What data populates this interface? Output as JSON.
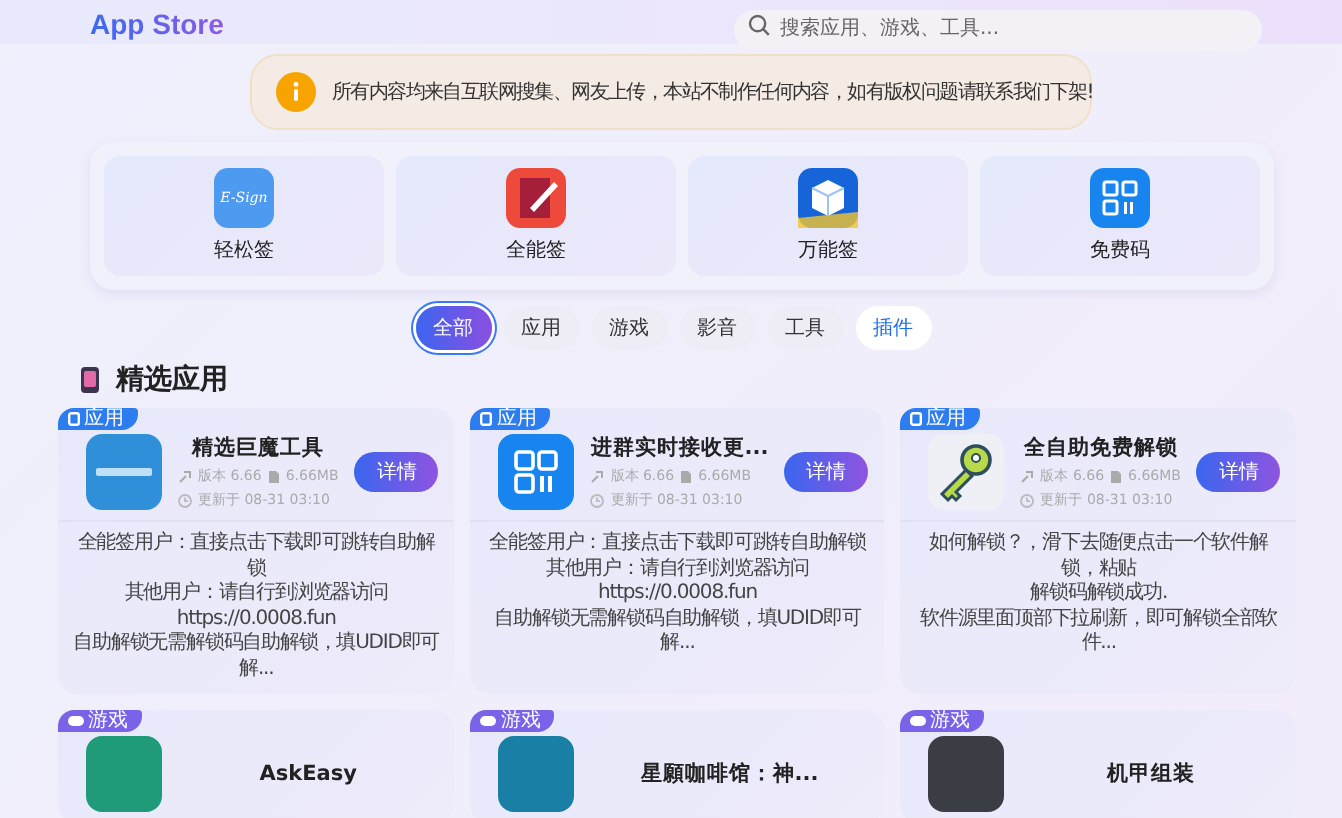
{
  "header": {
    "logo": "App Store",
    "search": {
      "placeholder": "搜索应用、游戏、工具..."
    }
  },
  "notice": {
    "text": "所有内容均来自互联网搜集、网友上传，本站不制作任何内容，如有版权问题请联系我们下架!"
  },
  "shortcuts": [
    {
      "label": "轻松签",
      "kind": "esign",
      "icon_text": "E-Sign"
    },
    {
      "label": "全能签",
      "kind": "pen"
    },
    {
      "label": "万能签",
      "kind": "cube"
    },
    {
      "label": "免费码",
      "kind": "qr"
    }
  ],
  "filters": [
    {
      "label": "全部",
      "selected": true,
      "hovered": false
    },
    {
      "label": "应用",
      "selected": false,
      "hovered": false
    },
    {
      "label": "游戏",
      "selected": false,
      "hovered": false
    },
    {
      "label": "影音",
      "selected": false,
      "hovered": false
    },
    {
      "label": "工具",
      "selected": false,
      "hovered": false
    },
    {
      "label": "插件",
      "selected": false,
      "hovered": true
    }
  ],
  "section": {
    "title": "精选应用"
  },
  "apps": [
    {
      "badge": "应用",
      "kind": "app",
      "title": "精选巨魔工具",
      "version": "版本 6.66",
      "size": "6.66MB",
      "updated": "更新于 08-31 03:10",
      "button": "详情",
      "description": [
        "全能签用户：直接点击下载即可跳转自助解锁",
        "其他用户：请自行到浏览器访问https://0.0008.fun",
        "自助解锁无需解锁码自助解锁，填UDID即可解..."
      ]
    },
    {
      "badge": "应用",
      "kind": "app",
      "title": "进群实时接收更...",
      "version": "版本 6.66",
      "size": "6.66MB",
      "updated": "更新于 08-31 03:10",
      "button": "详情",
      "description": [
        "全能签用户：直接点击下载即可跳转自助解锁",
        "其他用户：请自行到浏览器访问https://0.0008.fun",
        "自助解锁无需解锁码自助解锁，填UDID即可解..."
      ]
    },
    {
      "badge": "应用",
      "kind": "app",
      "title": "全自助免费解锁",
      "version": "版本 6.66",
      "size": "6.66MB",
      "updated": "更新于 08-31 03:10",
      "button": "详情",
      "description": [
        "如何解锁？，滑下去随便点击一个软件解锁，粘贴",
        "解锁码解锁成功.",
        "软件源里面顶部下拉刷新，即可解锁全部软件..."
      ]
    },
    {
      "badge": "游戏",
      "kind": "game",
      "title": "AskEasy"
    },
    {
      "badge": "游戏",
      "kind": "game",
      "title": "星願咖啡馆：神..."
    },
    {
      "badge": "游戏",
      "kind": "game",
      "title": "机甲组装"
    }
  ]
}
